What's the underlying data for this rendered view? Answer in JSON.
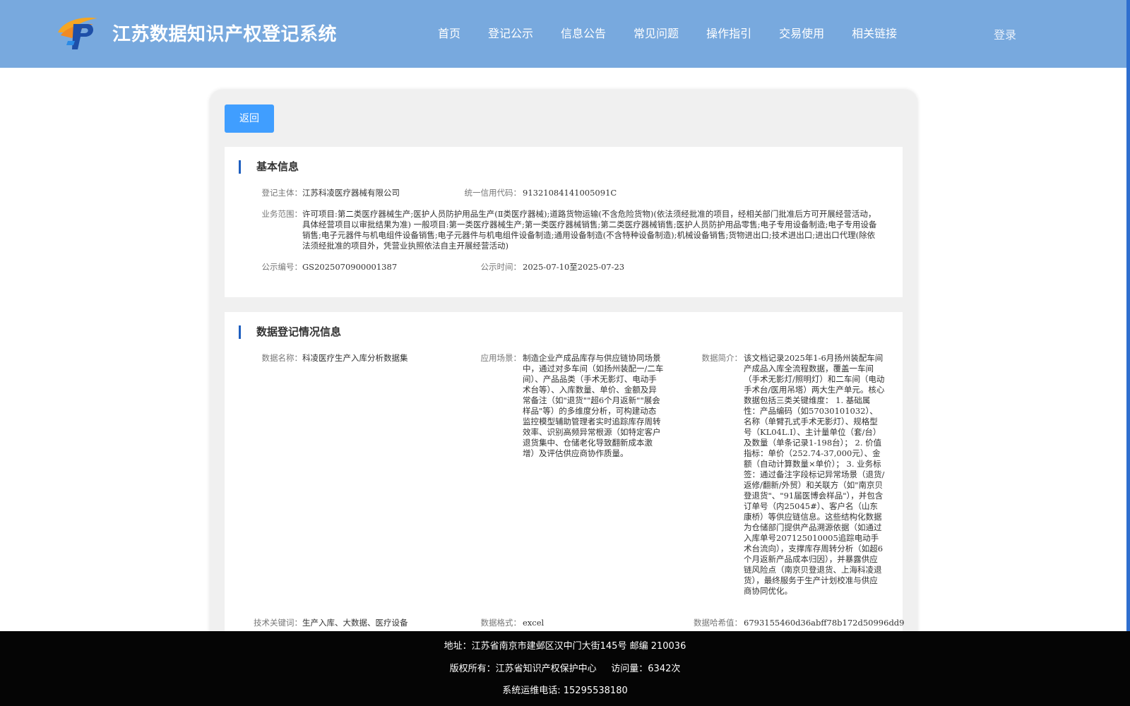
{
  "header": {
    "title": "江苏数据知识产权登记系统",
    "nav": [
      "首页",
      "登记公示",
      "信息公告",
      "常见问题",
      "操作指引",
      "交易使用",
      "相关链接"
    ],
    "login": "登录"
  },
  "back_label": "返回",
  "basic": {
    "title": "基本信息",
    "subject_label": "登记主体：",
    "subject": "江苏科凌医疗器械有限公司",
    "credit_label": "统一信用代码：",
    "credit": "91321084141005091C",
    "scope_label": "业务范围：",
    "scope": "许可项目:第二类医疗器械生产;医护人员防护用品生产(Ⅱ类医疗器械);道路货物运输(不含危险货物)(依法须经批准的项目，经相关部门批准后方可开展经营活动，具体经营项目以审批结果为准) 一般项目:第一类医疗器械生产;第一类医疗器械销售;第二类医疗器械销售;医护人员防护用品零售;电子专用设备制造;电子专用设备销售;电子元器件与机电组件设备销售;电子元器件与机电组件设备制造;通用设备制造(不含特种设备制造);机械设备销售;货物进出口;技术进出口;进出口代理(除依法须经批准的项目外，凭营业执照依法自主开展经营活动)",
    "pub_no_label": "公示编号：",
    "pub_no": "GS2025070900001387",
    "pub_time_label": "公示时间：",
    "pub_time": "2025-07-10至2025-07-23"
  },
  "registration": {
    "title": "数据登记情况信息",
    "name_label": "数据名称：",
    "name": "科凌医疗生产入库分析数据集",
    "scene_label": "应用场景：",
    "scene": "制造企业产成品库存与供应链协同场景中，通过对多车间（如扬州装配一/二车间）、产品品类（手术无影灯、电动手术台等）、入库数量、单价、金额及异常备注（如\"退货\"\"超6个月返新\"\"展会样品\"等）的多维度分析，可构建动态监控模型辅助管理者实时追踪库存周转效率、识别高频异常根源（如特定客户退货集中、仓储老化导致翻新成本激增）及评估供应商协作质量。",
    "intro_label": "数据简介：",
    "intro": "该文档记录2025年1-6月扬州装配车间产成品入库全流程数据，覆盖一车间（手术无影灯/照明灯）和二车间（电动手术台/医用吊塔）两大生产单元。核心数据包括三类关键维度： 1. 基础属性：产品编码（如57030101032）、名称（单臂孔式手术无影灯）、规格型号（KL04L.I）、主计量单位（套/台）及数量（单条记录1-198台）； 2. 价值指标：单价（252.74-37,000元）、金额（自动计算数量×单价）； 3. 业务标签：通过备注字段标记异常场景（退货/返修/翻新/外贸）和关联方（如\"南京贝登退货\"、\"91届医博会样品\"），并包含订单号（内25045#）、客户名（山东康桥）等供应链信息。这些结构化数据为仓储部门提供产品溯源依据（如通过入库单号207125010005追踪电动手术台流向），支撑库存周转分析（如超6个月返新产品成本归因），并暴露供应链风险点（南京贝登退货、上海科凌退货），最终服务于生产计划校准与供应商协同优化。",
    "keywords_label": "技术关键词：",
    "keywords": "生产入库、大数据、医疗设备",
    "format_label": "数据格式：",
    "format": "excel",
    "hash_label": "数据哈希值：",
    "hash": "6793155460d36abff78b172d50996dd9"
  },
  "footer": {
    "address": "地址：江苏省南京市建邺区汉中门大街145号 邮编 210036",
    "copyright": "版权所有：江苏省知识产权保护中心     访问量：6342次",
    "phone": "系统运维电话: 15295538180"
  },
  "colors": {
    "header_bg": "#78a9de",
    "primary_button": "#409eff",
    "section_accent": "#1f5fbf",
    "footer_bg": "#050505"
  },
  "icons": {
    "logo": "logo-icon"
  }
}
